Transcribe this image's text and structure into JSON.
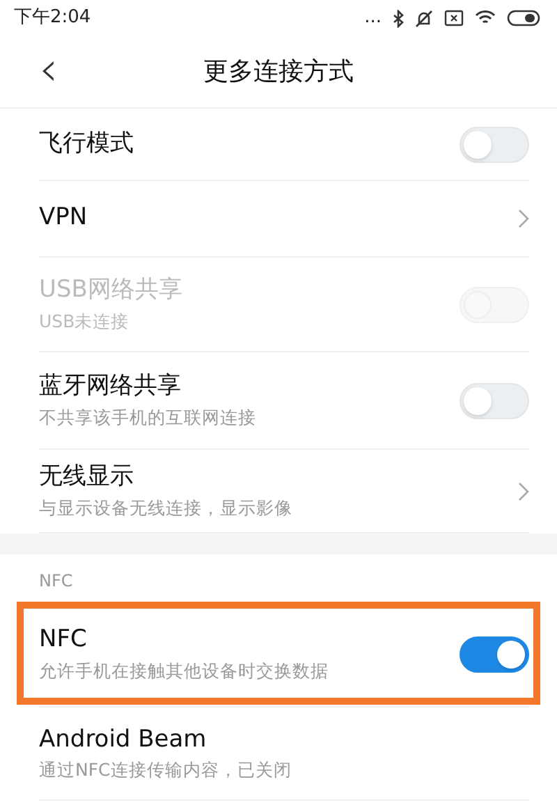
{
  "status_bar": {
    "time": "下午2:04",
    "dots": "..."
  },
  "header": {
    "back": "‹",
    "title": "更多连接方式"
  },
  "groups": [
    {
      "items": [
        {
          "kind": "toggle",
          "title": "飞行模式",
          "on": false,
          "disabled": false,
          "highlighted": false
        },
        {
          "kind": "link",
          "title": "VPN",
          "highlighted": false
        },
        {
          "kind": "toggle",
          "title": "USB网络共享",
          "subtitle": "USB未连接",
          "on": false,
          "disabled": true,
          "highlighted": false
        },
        {
          "kind": "toggle",
          "title": "蓝牙网络共享",
          "subtitle": "不共享该手机的互联网连接",
          "on": false,
          "disabled": false,
          "highlighted": false
        },
        {
          "kind": "link",
          "title": "无线显示",
          "subtitle": "与显示设备无线连接，显示影像",
          "highlighted": false
        }
      ]
    },
    {
      "heading": "NFC",
      "items": [
        {
          "kind": "toggle",
          "title": "NFC",
          "subtitle": "允许手机在接触其他设备时交换数据",
          "on": true,
          "disabled": false,
          "highlighted": true
        },
        {
          "kind": "plain",
          "title": "Android Beam",
          "subtitle": "通过NFC连接传输内容，已关闭",
          "highlighted": false
        }
      ]
    }
  ]
}
